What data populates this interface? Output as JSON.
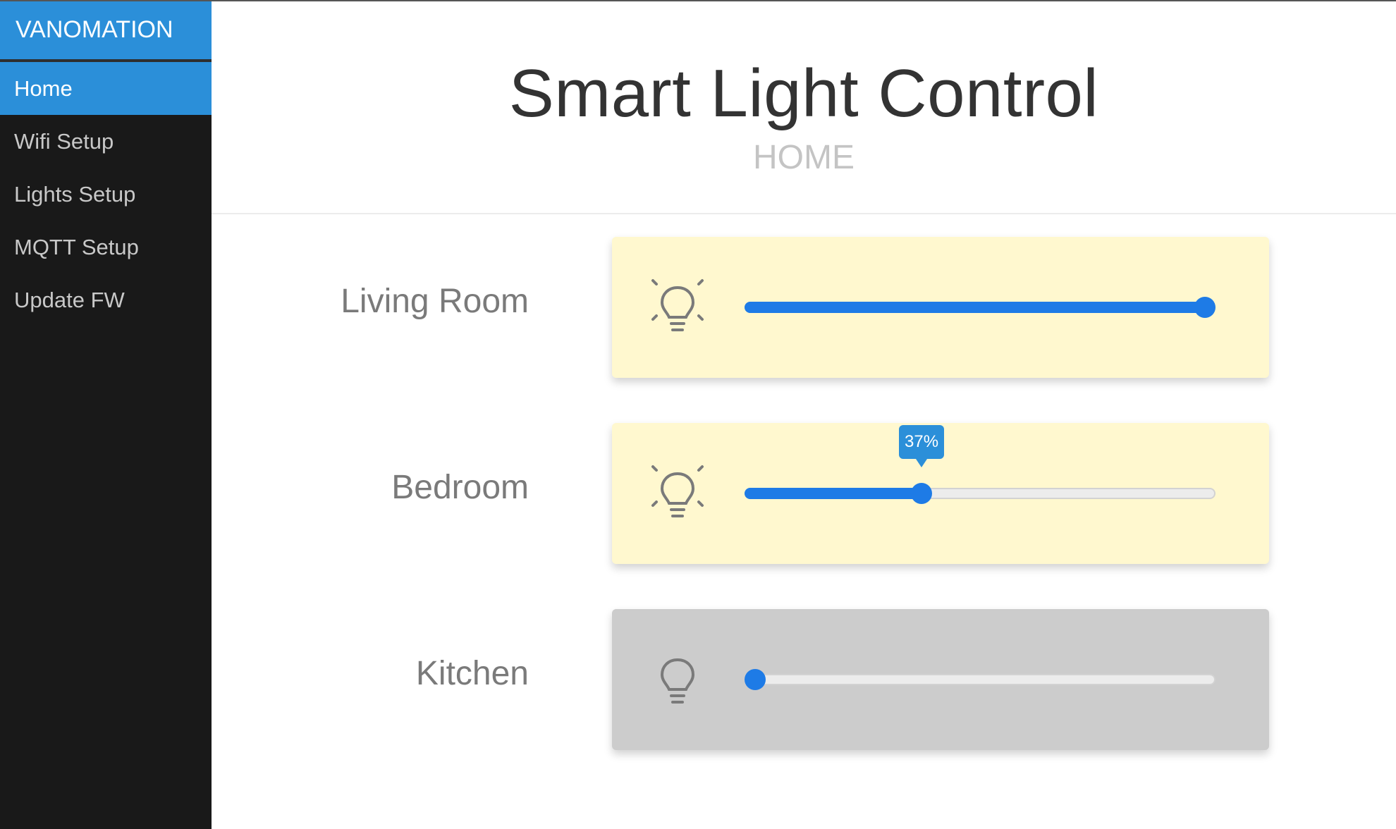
{
  "app": {
    "brand": "VANOMATION"
  },
  "sidebar": {
    "items": [
      {
        "label": "Home",
        "active": true
      },
      {
        "label": "Wifi Setup",
        "active": false
      },
      {
        "label": "Lights Setup",
        "active": false
      },
      {
        "label": "MQTT Setup",
        "active": false
      },
      {
        "label": "Update FW",
        "active": false
      }
    ]
  },
  "header": {
    "title": "Smart Light Control",
    "subtitle": "HOME"
  },
  "lights": [
    {
      "name": "Living Room",
      "on": true,
      "level_percent": 100,
      "icon": "lightbulb-on-icon"
    },
    {
      "name": "Bedroom",
      "on": true,
      "level_percent": 37,
      "tooltip": "37%",
      "icon": "lightbulb-on-icon"
    },
    {
      "name": "Kitchen",
      "on": false,
      "level_percent": 0,
      "icon": "lightbulb-off-icon"
    }
  ],
  "colors": {
    "accent": "#2b8fd9",
    "slider": "#1e7be6",
    "card_on": "#fff8cf",
    "card_off": "#cccccc",
    "sidebar_bg": "#191919"
  }
}
